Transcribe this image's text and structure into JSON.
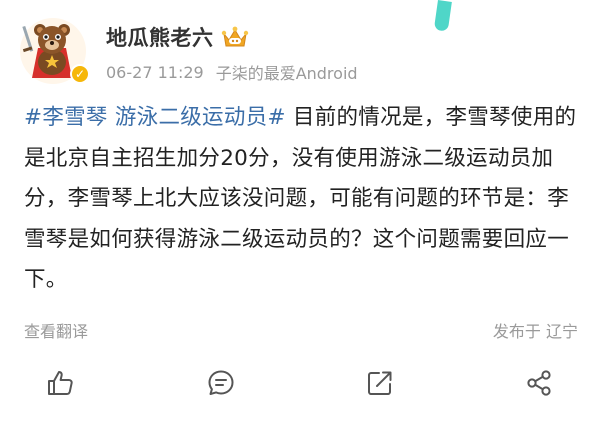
{
  "user": {
    "name": "地瓜熊老六",
    "crown_badge_icon": "crown-badge-icon",
    "verify_icon": "verified-check-icon"
  },
  "meta": {
    "timestamp": "06-27 11:29",
    "source": "子柒的最爱Android"
  },
  "post": {
    "hashtag": "#李雪琴 游泳二级运动员#",
    "text": " 目前的情况是，李雪琴使用的是北京自主招生加分20分，没有使用游泳二级运动员加分，李雪琴上北大应该没问题，可能有问题的环节是：李雪琴是如何获得游泳二级运动员的？这个问题需要回应一下。"
  },
  "footer": {
    "translate_label": "查看翻译",
    "location_label": "发布于 辽宁"
  },
  "actions": [
    {
      "icon": "like-icon"
    },
    {
      "icon": "comment-icon"
    },
    {
      "icon": "repost-icon"
    },
    {
      "icon": "share-icon"
    }
  ],
  "colors": {
    "hashtag": "#3b6ea8",
    "meta_text": "#9a9a9a",
    "body_text": "#222222",
    "accent_teal": "#4fd6c8",
    "badge_gold": "#f6b70a"
  }
}
